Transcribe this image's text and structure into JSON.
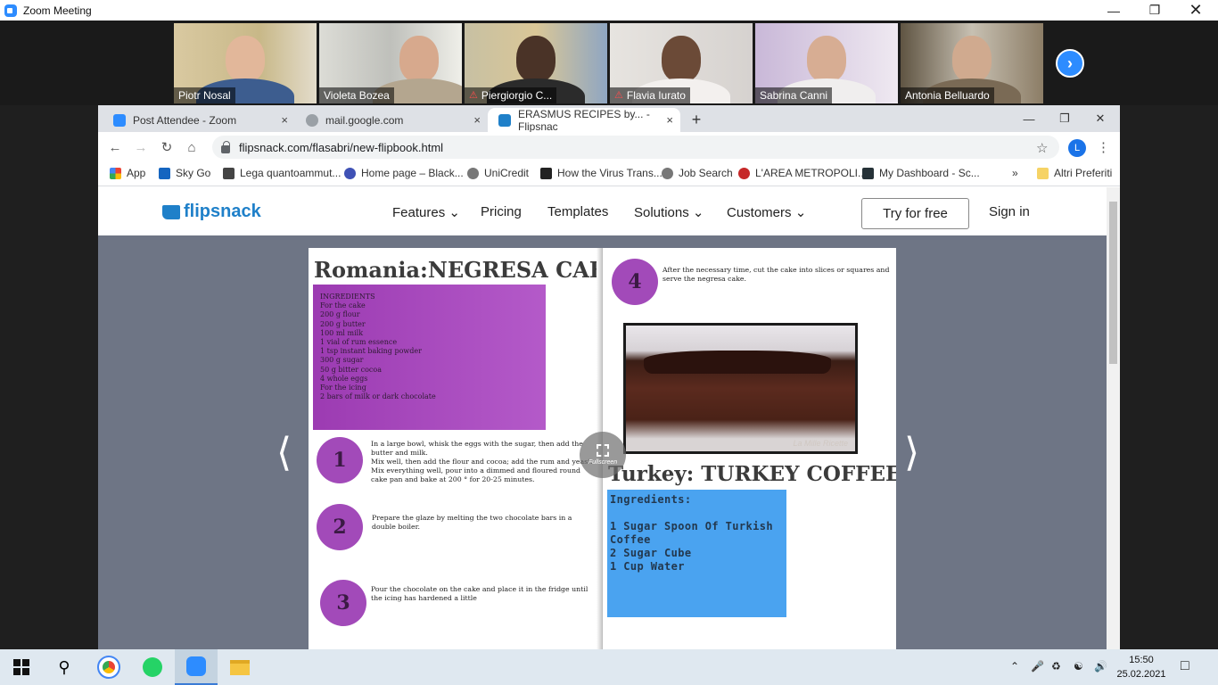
{
  "zoom": {
    "title": "Zoom Meeting",
    "participants": [
      {
        "name": "Piotr Nosal",
        "muted": false
      },
      {
        "name": "Violeta Bozea",
        "muted": false,
        "active": true
      },
      {
        "name": "Piergiorgio C...",
        "muted": true
      },
      {
        "name": "Flavia Iurato",
        "muted": true
      },
      {
        "name": "Sabrina Canni",
        "muted": false
      },
      {
        "name": "Antonia Belluardo",
        "muted": false
      }
    ],
    "next_icon": "chevron-right-icon"
  },
  "browser": {
    "tabs": [
      {
        "label": "Post Attendee - Zoom",
        "close": "×"
      },
      {
        "label": "mail.google.com",
        "close": "×"
      },
      {
        "label": "ERASMUS RECIPES by... - Flipsnac",
        "close": "×",
        "active": true
      }
    ],
    "newtab": "+",
    "url": "flipsnack.com/flasabri/new-flipbook.html",
    "profile_initial": "L",
    "bookmarks": [
      "App",
      "Sky Go",
      "Lega quantoammut...",
      "Home page – Black...",
      "UniCredit",
      "How the Virus Trans...",
      "Job Search",
      "L'AREA METROPOLI...",
      "My Dashboard - Sc..."
    ],
    "bookmarks_more": "»",
    "other_bookmarks": "Altri Preferiti"
  },
  "flipsnack": {
    "brand": "flipsnack",
    "nav": [
      "Features",
      "Pricing",
      "Templates",
      "Solutions",
      "Customers"
    ],
    "try_label": "Try for free",
    "signin_label": "Sign in",
    "fullscreen_label": "Fullscreen",
    "left_page": {
      "title": "Romania:NEGRESA CAKE",
      "ingredients": [
        "INGREDIENTS",
        "For the cake",
        "200 g flour",
        "200 g butter",
        "100 ml milk",
        "1 vial of rum essence",
        "1 tsp instant baking powder",
        "300 g sugar",
        "50 g bitter cocoa",
        "4 whole eggs",
        "For the icing",
        "2 bars of milk or dark chocolate"
      ],
      "steps": [
        {
          "num": "1",
          "text": "In a large bowl, whisk the eggs with the sugar, then add the butter and milk.\nMix well, then add the flour and cocoa; add the rum and yeast.\nMix everything well, pour into a dimmed and floured round cake pan and bake at 200 ° for 20-25 minutes."
        },
        {
          "num": "2",
          "text": "Prepare the glaze by melting the two chocolate bars in a double boiler."
        },
        {
          "num": "3",
          "text": "Pour the chocolate on the cake and place it in the fridge until the icing has hardened a little"
        }
      ]
    },
    "right_page": {
      "step4": {
        "num": "4",
        "text": "After the necessary time, cut the cake into slices or squares and serve the negresa cake."
      },
      "image_watermark": "La Mille Ricette",
      "title": "Turkey: TURKEY COFFEE",
      "ingredients": [
        "Ingredients:",
        "",
        "1 Sugar Spoon Of Turkish",
        "Coffee",
        "2 Sugar Cube",
        "1 Cup Water"
      ]
    }
  },
  "taskbar": {
    "time": "15:50",
    "date": "25.02.2021"
  },
  "colors": {
    "zoom_blue": "#2d8cff",
    "flipsnack_blue": "#1f80c9",
    "recipe_purple": "#a24ab9",
    "coffee_blue": "#4aa3f0"
  }
}
